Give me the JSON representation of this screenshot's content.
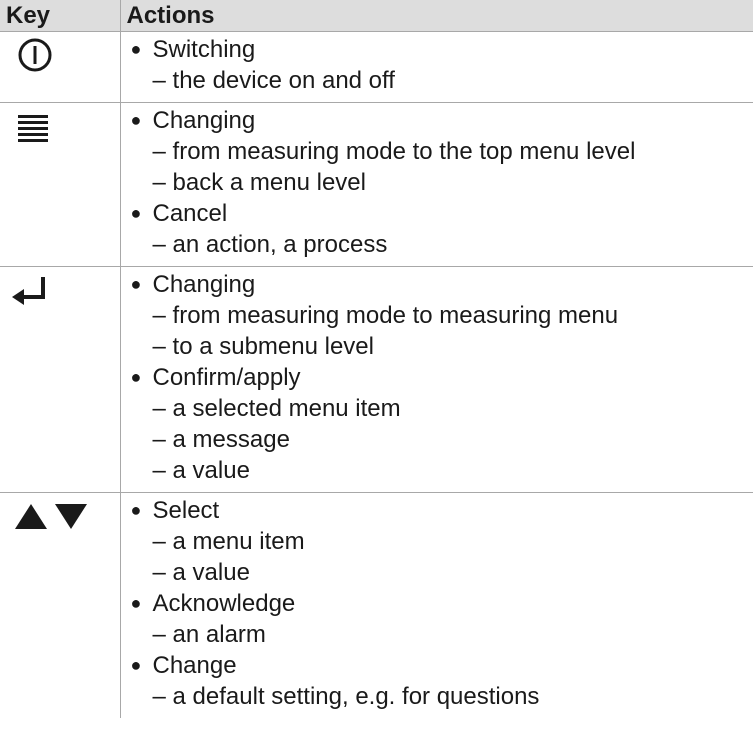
{
  "table": {
    "headers": {
      "key": "Key",
      "actions": "Actions"
    },
    "rows": [
      {
        "key_icon": "power-icon",
        "groups": [
          {
            "bullet": "Switching",
            "subs": [
              "the device on and off"
            ]
          }
        ]
      },
      {
        "key_icon": "menu-icon",
        "groups": [
          {
            "bullet": "Changing",
            "subs": [
              "from measuring mode to the top menu level",
              "back a menu level"
            ]
          },
          {
            "bullet": "Cancel",
            "subs": [
              "an action, a process"
            ]
          }
        ]
      },
      {
        "key_icon": "enter-icon",
        "groups": [
          {
            "bullet": "Changing",
            "subs": [
              "from measuring mode to measuring menu",
              "to a submenu level"
            ]
          },
          {
            "bullet": "Confirm/apply",
            "subs": [
              "a selected menu item",
              "a message",
              "a value"
            ]
          }
        ]
      },
      {
        "key_icon": "up-down-arrows-icon",
        "groups": [
          {
            "bullet": "Select",
            "subs": [
              "a menu item",
              "a value"
            ]
          },
          {
            "bullet": "Acknowledge",
            "subs": [
              "an alarm"
            ]
          },
          {
            "bullet": "Change",
            "subs": [
              "a default setting, e.g. for questions"
            ]
          }
        ]
      }
    ],
    "bullet_glyph": "●",
    "dash_glyph": "–"
  }
}
